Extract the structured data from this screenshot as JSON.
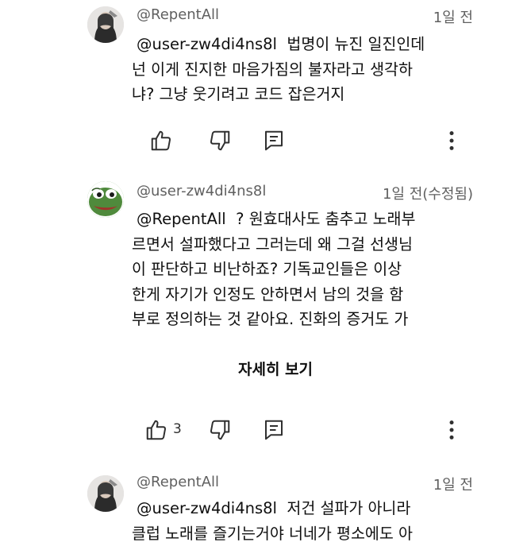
{
  "comments": [
    {
      "author": "@RepentAll",
      "time": "1일 전",
      "mention": "@user-zw4di4ns8l",
      "lines": [
        "법명이 뉴진 일진인데",
        "넌 이게 진지한 마음가짐의 불자라고 생각하",
        "냐? 그냥 웃기려고 코드 잡은거지"
      ],
      "like_count": ""
    },
    {
      "author": "@user-zw4di4ns8l",
      "time": "1일 전(수정됨)",
      "mention": "@RepentAll",
      "lines": [
        "? 원효대사도 춤추고 노래부",
        "르면서 설파했다고 그러는데 왜 그걸 선생님",
        "이 판단하고 비난하죠? 기독교인들은 이상",
        "한게 자기가 인정도 안하면서 남의 것을 함",
        "부로 정의하는 것 같아요. 진화의 증거도 가"
      ],
      "show_more": "자세히 보기",
      "like_count": "3"
    },
    {
      "author": "@RepentAll",
      "time": "1일 전",
      "mention": "@user-zw4di4ns8l",
      "lines": [
        "저건 설파가 아니라",
        "클럽 노래를 즐기는거야 너네가 평소에도 아"
      ]
    }
  ],
  "icons": {
    "like": "thumbs-up-icon",
    "dislike": "thumbs-down-icon",
    "reply": "reply-icon",
    "menu": "more-vert-icon"
  },
  "colors": {
    "text": "#0f0f0f",
    "meta": "#606060",
    "icon": "#303030",
    "avatar_green": "#4f8a3c"
  }
}
